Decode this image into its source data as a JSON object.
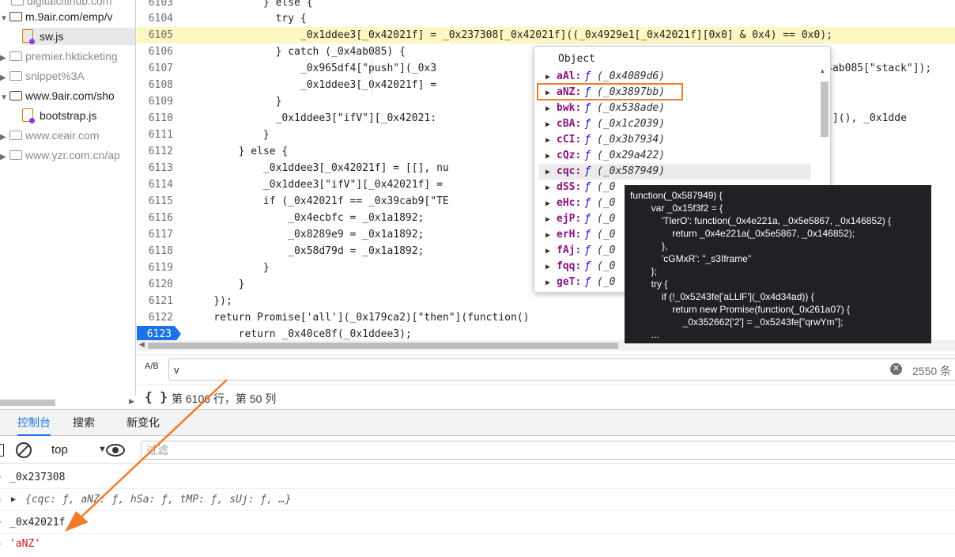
{
  "file_tree": {
    "items": [
      {
        "label": "digitalcitihub.com",
        "kind": "folder",
        "state": "muted"
      },
      {
        "label": "m.9air.com/emp/v",
        "kind": "folder",
        "state": "open"
      },
      {
        "label": "sw.js",
        "kind": "file",
        "state": "selected"
      },
      {
        "label": "premier.hkticketing",
        "kind": "folder",
        "state": "muted"
      },
      {
        "label": "snippet%3A",
        "kind": "folder",
        "state": "muted"
      },
      {
        "label": "www.9air.com/sho",
        "kind": "folder",
        "state": "open"
      },
      {
        "label": "bootstrap.js",
        "kind": "file",
        "state": "normal"
      },
      {
        "label": "www.ceair.com",
        "kind": "folder",
        "state": "muted"
      },
      {
        "label": "www.yzr.com.cn/ap",
        "kind": "folder",
        "state": "muted"
      }
    ]
  },
  "editor": {
    "lines": [
      {
        "n": "6103",
        "t": "            } else {"
      },
      {
        "n": "6104",
        "t": "              try {"
      },
      {
        "n": "6105",
        "t": "                  _0x1ddee3[_0x42021f] = _0x237308[_0x42021f]((_0x4929e1[_0x42021f][0x0] & 0x4) == 0x0);"
      },
      {
        "n": "6106",
        "t": "              } catch (_0x4ab085) {"
      },
      {
        "n": "6107",
        "t": "                  _0x965df4[\"push\"](_0x3                                                              x4ab085[\"stack\"]);"
      },
      {
        "n": "6108",
        "t": "                  _0x1ddee3[_0x42021f] ="
      },
      {
        "n": "6109",
        "t": "              }"
      },
      {
        "n": "6110",
        "t": "              _0x1ddee3[\"ifV\"][_0x42021:                                                        ce[\"now\"](), _0x1dde"
      },
      {
        "n": "6111",
        "t": "            }"
      },
      {
        "n": "6112",
        "t": "        } else {"
      },
      {
        "n": "6113",
        "t": "            _0x1ddee3[_0x42021f] = [[], nu"
      },
      {
        "n": "6114",
        "t": "            _0x1ddee3[\"ifV\"][_0x42021f] ="
      },
      {
        "n": "6115",
        "t": "            if (_0x42021f == _0x39cab9[\"TE"
      },
      {
        "n": "6116",
        "t": "                _0x4ecbfc = _0x1a1892;"
      },
      {
        "n": "6117",
        "t": "                _0x8289e9 = _0x1a1892;"
      },
      {
        "n": "6118",
        "t": "                _0x58d79d = _0x1a1892;"
      },
      {
        "n": "6119",
        "t": "            }"
      },
      {
        "n": "6120",
        "t": "        }"
      },
      {
        "n": "6121",
        "t": "    });"
      },
      {
        "n": "6122",
        "t": "    return Promise['all'](_0x179ca2)[\"then\"](function()"
      },
      {
        "n": "6123",
        "t": "        return _0x40ce8f(_0x1ddee3);"
      }
    ]
  },
  "object_popover": {
    "title": "Object",
    "props": [
      {
        "key": "aAl",
        "f": "ƒ",
        "val": "(_0x4089d6)"
      },
      {
        "key": "aNZ",
        "f": "ƒ",
        "val": "(_0x3897bb)"
      },
      {
        "key": "bwk",
        "f": "ƒ",
        "val": "(_0x538ade)"
      },
      {
        "key": "cBA",
        "f": "ƒ",
        "val": "(_0x1c2039)"
      },
      {
        "key": "cCI",
        "f": "ƒ",
        "val": "(_0x3b7934)"
      },
      {
        "key": "cQz",
        "f": "ƒ",
        "val": "(_0x29a422)"
      },
      {
        "key": "cqc",
        "f": "ƒ",
        "val": "(_0x587949)"
      },
      {
        "key": "dSS",
        "f": "ƒ",
        "val": "(_0"
      },
      {
        "key": "eHc",
        "f": "ƒ",
        "val": "(_0"
      },
      {
        "key": "ejP",
        "f": "ƒ",
        "val": "(_0"
      },
      {
        "key": "erH",
        "f": "ƒ",
        "val": "(_0"
      },
      {
        "key": "fAj",
        "f": "ƒ",
        "val": "(_0"
      },
      {
        "key": "fqq",
        "f": "ƒ",
        "val": "(_0"
      },
      {
        "key": "geT",
        "f": "ƒ",
        "val": "(_0"
      }
    ]
  },
  "tooltip": {
    "lines": [
      "function(_0x587949) {",
      "        var _0x15f3f2 = {",
      "            'TlerO': function(_0x4e221a, _0x5e5867, _0x146852) {",
      "                return _0x4e221a(_0x5e5867, _0x146852);",
      "            },",
      "            'cGMxR': \"_s3Iframe\"",
      "        };",
      "        try {",
      "            if (!_0x5243fe['aLLlF'](_0x4d34ad)) {",
      "                return new Promise(function(_0x261a07) {",
      "                    _0x352662['2'] = _0x5243fe[\"qrwYm\"];",
      "        ..."
    ]
  },
  "search": {
    "match_case_icon": "A/B",
    "value": "v",
    "count": "2550 条"
  },
  "status": {
    "braces": "{ }",
    "position": "第 6106 行，第 50 列"
  },
  "drawer": {
    "tabs": [
      "控制台",
      "搜索",
      "新变化"
    ]
  },
  "console_toolbar": {
    "context": "top",
    "filter_placeholder": "过滤"
  },
  "console": {
    "entries": [
      {
        "type": "input",
        "text": "_0x237308"
      },
      {
        "type": "object",
        "text": "{cqc: ƒ, aNZ: ƒ, hSa: ƒ, tMP: ƒ, sUj: ƒ,  …}"
      },
      {
        "type": "input",
        "text": "_0x42021f"
      },
      {
        "type": "result",
        "text": "'aNZ'"
      }
    ]
  },
  "colors": {
    "accent": "#1a73e8",
    "annotation": "#f07c2a",
    "current_line": "#fff7c2",
    "tooltip_bg": "#202124"
  }
}
